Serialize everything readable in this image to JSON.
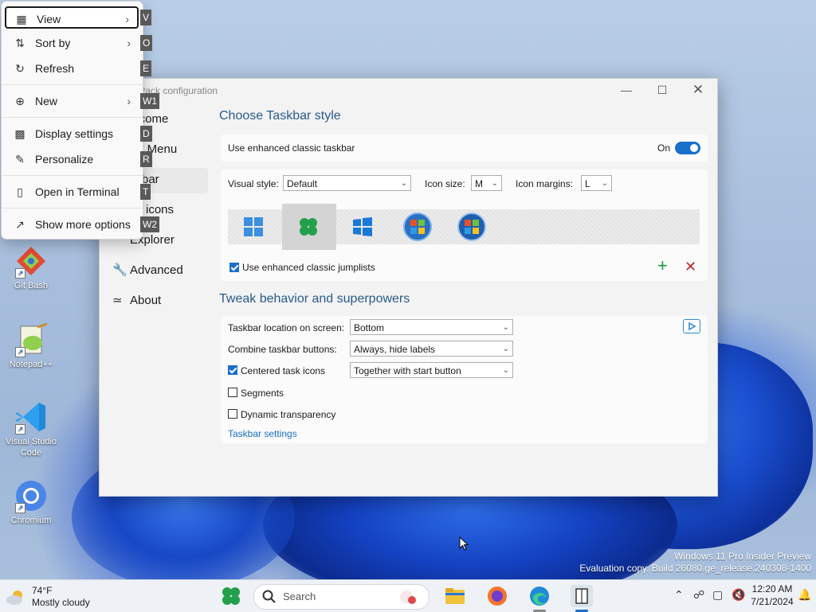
{
  "context_menu": {
    "items": [
      {
        "label": "View",
        "key": "V"
      },
      {
        "label": "Sort by",
        "key": "O"
      },
      {
        "label": "Refresh",
        "key": "E"
      },
      {
        "label": "New",
        "key": "W1"
      },
      {
        "label": "Display settings",
        "key": "D"
      },
      {
        "label": "Personalize",
        "key": "R"
      },
      {
        "label": "Open in Terminal",
        "key": "T"
      },
      {
        "label": "Show more options",
        "key": "W2"
      }
    ]
  },
  "window": {
    "title": "ExplorerPatcher / ...llPack configuration",
    "title_visible": "llPack configuration",
    "nav": [
      {
        "label": "elcome",
        "icon": "home-icon"
      },
      {
        "label": "art Menu",
        "icon": "start-icon"
      },
      {
        "label": "skbar",
        "icon": "taskbar-icon"
      },
      {
        "label": "ay icons",
        "icon": "tray-icon"
      },
      {
        "label": "Explorer",
        "icon": "folder-icon"
      },
      {
        "label": "Advanced",
        "icon": "wrench-icon"
      },
      {
        "label": "About",
        "icon": "about-icon"
      }
    ],
    "section1_title": "Choose Taskbar style",
    "enhanced_taskbar_label": "Use enhanced classic taskbar",
    "enhanced_taskbar_state": "On",
    "visual_style_label": "Visual style:",
    "visual_style_value": "Default",
    "icon_size_label": "Icon size:",
    "icon_size_value": "M",
    "icon_margins_label": "Icon margins:",
    "icon_margins_value": "L",
    "jumplists_label": "Use enhanced classic jumplists",
    "section2_title": "Tweak behavior and superpowers",
    "location_label": "Taskbar location on screen:",
    "location_value": "Bottom",
    "combine_label": "Combine taskbar buttons:",
    "combine_value": "Always, hide labels",
    "centered_label": "Centered task icons",
    "centered_value": "Together with start button",
    "segments_label": "Segments",
    "dynamic_label": "Dynamic transparency",
    "taskbar_settings_link": "Taskbar settings"
  },
  "desktop_icons": [
    {
      "label": "Git Bash"
    },
    {
      "label": "Notepad++"
    },
    {
      "label": "Visual Studio Code"
    },
    {
      "label": "Chromium"
    }
  ],
  "watermark": {
    "line1": "Windows 11 Pro Insider Preview",
    "line2": "Evaluation copy. Build 26080.ge_release.240308-1400"
  },
  "taskbar": {
    "weather_temp": "74°F",
    "weather_desc": "Mostly cloudy",
    "search_placeholder": "Search",
    "time": "12:20 AM",
    "date": "7/21/2024"
  },
  "colors": {
    "accent": "#1a6fc9",
    "heading": "#2a5a8e"
  }
}
